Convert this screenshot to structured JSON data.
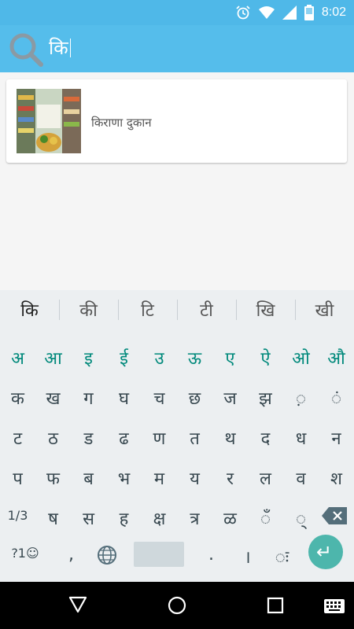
{
  "status": {
    "time": "8:02"
  },
  "search": {
    "query": "कि"
  },
  "results": [
    {
      "title": "किराणा दुकान"
    }
  ],
  "keyboard": {
    "suggestions": [
      "कि",
      "की",
      "टि",
      "टी",
      "खि",
      "खी"
    ],
    "row1": [
      "अ",
      "आ",
      "इ",
      "ई",
      "उ",
      "ऊ",
      "ए",
      "ऐ",
      "ओ",
      "औ"
    ],
    "row2": [
      "क",
      "ख",
      "ग",
      "घ",
      "च",
      "छ",
      "ज",
      "झ",
      "़",
      "ं"
    ],
    "row3": [
      "ट",
      "ठ",
      "ड",
      "ढ",
      "ण",
      "त",
      "थ",
      "द",
      "ध",
      "न"
    ],
    "row4": [
      "प",
      "फ",
      "ब",
      "भ",
      "म",
      "य",
      "र",
      "ल",
      "व",
      "श"
    ],
    "row5": [
      "ष",
      "स",
      "ह",
      "क्ष",
      "त्र",
      "ळ",
      "ँ",
      "्"
    ],
    "row5_left": "1/3",
    "bottom": {
      "symbols": "?1☺",
      "comma": ",",
      "period": ".",
      "danda": "।",
      "visarga": "ः"
    }
  },
  "colors": {
    "appbar": "#55BDEB",
    "statusbar": "#4FB8E8",
    "vowel_keys": "#00897B",
    "enter": "#4DB6AC"
  }
}
